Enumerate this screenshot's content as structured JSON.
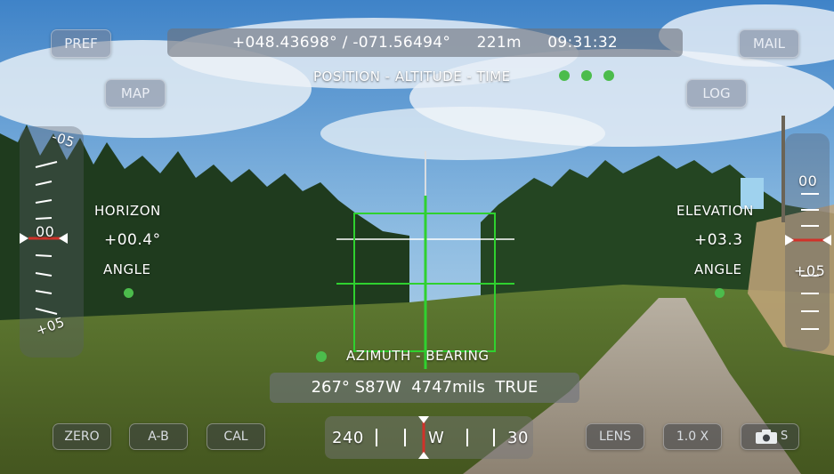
{
  "buttons": {
    "pref": "PREF",
    "mail": "MAIL",
    "map": "MAP",
    "log": "LOG",
    "zero": "ZERO",
    "ab": "A-B",
    "cal": "CAL",
    "lens": "LENS",
    "zoom": "1.0 X",
    "camera_mode": "S"
  },
  "top_bar": {
    "coords": "+048.43698° / -071.56494°",
    "altitude": "221m",
    "time": "09:31:32",
    "caption": "POSITION - ALTITUDE - TIME"
  },
  "horizon": {
    "title": "HORIZON",
    "value": "+00.4°",
    "subtitle": "ANGLE",
    "scale_top": "-05",
    "scale_mid": "00",
    "scale_bottom": "+05"
  },
  "elevation": {
    "title": "ELEVATION",
    "value": "+03.3",
    "subtitle": "ANGLE",
    "scale_top": "00",
    "scale_bottom": "+05"
  },
  "azimuth": {
    "caption": "AZIMUTH - BEARING",
    "readout": "267° S87W  4747mils  TRUE"
  },
  "compass": {
    "left_value": "240",
    "center_letter": "W",
    "right_value": "30"
  },
  "colors": {
    "reticle": "#2fd12f",
    "indicator_red": "#d0322a",
    "status_dot": "#4cbc4c"
  },
  "icons": {
    "camera": "camera-icon"
  }
}
